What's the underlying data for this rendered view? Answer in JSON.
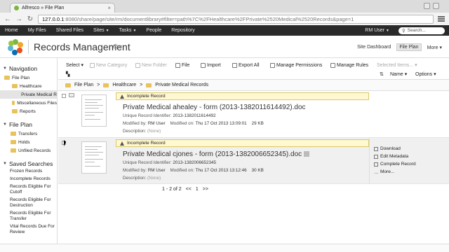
{
  "browser": {
    "tab_title": "Alfresco » File Plan",
    "url_host": "127.0.0.1",
    "url_rest": ":8080/share/page/site/rm/documentlibrary#filter=path%7C%2FHealthcare%2FPrivate%2520Medical%2520Records&page=1"
  },
  "appbar": {
    "items": [
      "Home",
      "My Files",
      "Shared Files",
      "Sites",
      "Tasks",
      "People",
      "Repository"
    ],
    "user": "RM User",
    "search_placeholder": "Search..."
  },
  "header": {
    "title": "Records Management",
    "nav": [
      "Site Dashboard",
      "File Plan",
      "More"
    ]
  },
  "sidebar": {
    "navigation_title": "Navigation",
    "file_plan_label": "File Plan",
    "healthcare": "Healthcare",
    "private_medical": "Private Medical R",
    "misc_files": "Miscellaneous Files",
    "reports": "Reports",
    "file_plan_section": "File Plan",
    "transfers": "Transfers",
    "holds": "Holds",
    "unfiled": "Unfiled Records",
    "saved_searches_title": "Saved Searches",
    "saved": [
      "Frozen Records",
      "Incomplete Records",
      "Records Eligible For Cutoff",
      "Records Eligible For Destruction",
      "Records Eligible For Transfer",
      "Vital Records Due For Review"
    ]
  },
  "toolbar": {
    "select": "Select",
    "new_category": "New Category",
    "new_folder": "New Folder",
    "file": "File",
    "import": "Import",
    "export_all": "Export All",
    "manage_permissions": "Manage Permissions",
    "manage_rules": "Manage Rules",
    "selected_items": "Selected Items...",
    "sort": "Name",
    "options": "Options"
  },
  "breadcrumb": [
    "File Plan",
    "Healthcare",
    "Private Medical Records"
  ],
  "records": [
    {
      "banner": "Incomplete Record",
      "title": "Private Medical ahealey - form (2013-1382011614492).doc",
      "identifier_label": "Unique Record Identifier:",
      "identifier": "2013-1382011614492",
      "modified_by_label": "Modified by:",
      "modified_by": "RM User",
      "modified_on_label": "Modified on:",
      "modified_on": "Thu 17 Oct 2013 13:09:01",
      "size": "29 KB",
      "description_label": "Description:",
      "description": "(None)"
    },
    {
      "banner": "Incomplete Record",
      "title": "Private Medical cjones - form (2013-1382006652345).doc",
      "identifier_label": "Unique Record Identifier:",
      "identifier": "2013-1382006652345",
      "modified_by_label": "Modified by:",
      "modified_by": "RM User",
      "modified_on_label": "Modified on:",
      "modified_on": "Thu 17 Oct 2013 13:12:46",
      "size": "30 KB",
      "description_label": "Description:",
      "description": "(None)"
    }
  ],
  "row_actions": [
    "Download",
    "Edit Metadata",
    "Complete Record",
    "More..."
  ],
  "pager": {
    "range": "1 - 2 of 2",
    "first": "<<",
    "page": "1",
    "last": ">>"
  }
}
